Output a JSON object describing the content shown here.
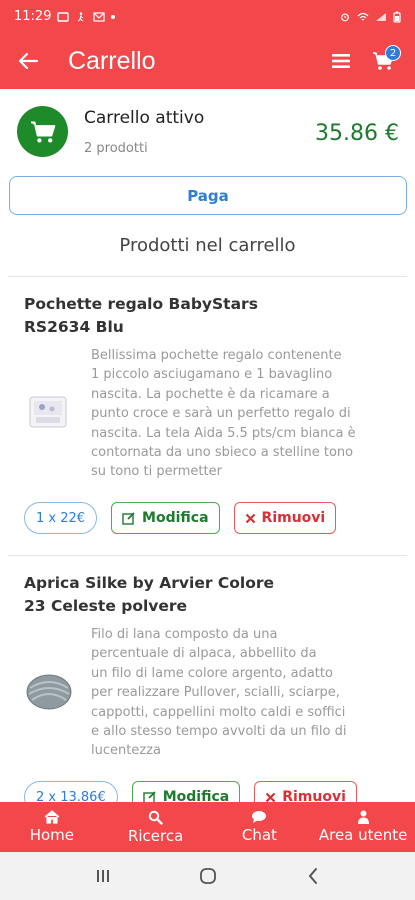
{
  "status_bar": {
    "time": "11:29"
  },
  "app_bar": {
    "title": "Carrello",
    "cart_badge": "2"
  },
  "cart": {
    "title": "Carrello attivo",
    "count_text": "2 prodotti",
    "total": "35.86 €",
    "pay_label": "Paga",
    "section_title": "Prodotti nel carrello"
  },
  "products": [
    {
      "name_line1": "Pochette regalo BabyStars",
      "name_line2": "RS2634 Blu",
      "desc_lines": [
        "Bellissima pochette regalo contenente",
        "1 piccolo asciugamano e 1 bavaglino",
        "nascita. La pochette è da ricamare a",
        "punto croce e sarà un perfetto regalo di",
        "nascita. La tela Aida 5.5 pts/cm bianca è",
        "contornata da uno sbieco a stelline tono",
        "su tono ti permetter"
      ],
      "qty": "1 x 22€",
      "edit_label": "Modifica",
      "remove_label": "Rimuovi"
    },
    {
      "name_line1": "Aprica Silke by Arvier  Colore",
      "name_line2": "23 Celeste polvere",
      "desc_lines": [
        "Filo di lana composto da una",
        "percentuale di alpaca, abbellito da",
        "un filo di lame colore argento, adatto",
        "per realizzare Pullover, scialli, sciarpe,",
        "cappotti, cappellini  molto caldi e soffici",
        "e allo stesso tempo avvolti da un filo  di",
        "lucentezza"
      ],
      "qty": "2 x 13.86€",
      "edit_label": "Modifica",
      "remove_label": "Rimuovi"
    }
  ],
  "tab_bar": {
    "home": "Home",
    "search": "Ricerca",
    "chat": "Chat",
    "account": "Area utente"
  },
  "colors": {
    "primary": "#f2484b",
    "accent_green": "#1e7b2d",
    "accent_blue": "#2d7dd9",
    "danger": "#d93036"
  }
}
